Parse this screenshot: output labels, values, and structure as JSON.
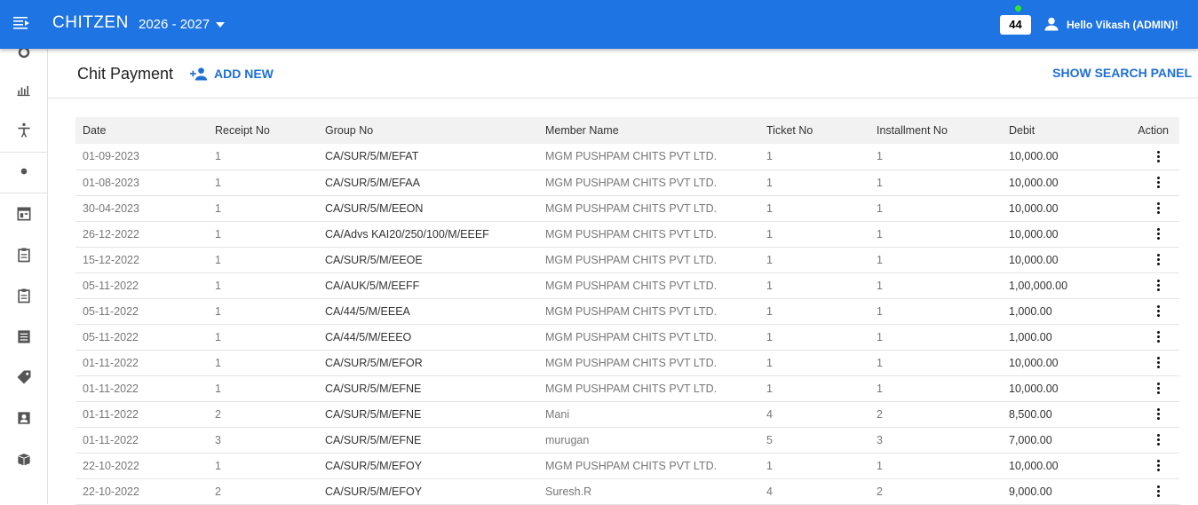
{
  "header": {
    "brand": "CHITZEN",
    "year": "2026 - 2027",
    "notification_count": "44",
    "greeting": "Hello Vikash (ADMIN)!"
  },
  "colors": {
    "topbar": "#1e74e2",
    "accent": "#1e6fd6",
    "notif_dot": "#2ee82e"
  },
  "sidebar": {
    "icons": [
      "settings-icon",
      "bar-chart-icon",
      "accessibility-icon",
      "dot-icon",
      "web-icon",
      "clipboard-icon",
      "clipboard-icon",
      "list-icon",
      "tag-icon",
      "account-box-icon",
      "package-icon"
    ]
  },
  "page": {
    "title": "Chit Payment",
    "add_new": "ADD NEW",
    "search_panel": "SHOW SEARCH PANEL"
  },
  "table": {
    "columns": [
      "Date",
      "Receipt No",
      "Group No",
      "Member Name",
      "Ticket No",
      "Installment No",
      "Debit",
      "Action"
    ],
    "rows": [
      [
        "01-09-2023",
        "1",
        "CA/SUR/5/M/EFAT",
        "MGM PUSHPAM CHITS PVT LTD.",
        "1",
        "1",
        "10,000.00"
      ],
      [
        "01-08-2023",
        "1",
        "CA/SUR/5/M/EFAA",
        "MGM PUSHPAM CHITS PVT LTD.",
        "1",
        "1",
        "10,000.00"
      ],
      [
        "30-04-2023",
        "1",
        "CA/SUR/5/M/EEON",
        "MGM PUSHPAM CHITS PVT LTD.",
        "1",
        "1",
        "10,000.00"
      ],
      [
        "26-12-2022",
        "1",
        "CA/Advs KAI20/250/100/M/EEEF",
        "MGM PUSHPAM CHITS PVT LTD.",
        "1",
        "1",
        "10,000.00"
      ],
      [
        "15-12-2022",
        "1",
        "CA/SUR/5/M/EEOE",
        "MGM PUSHPAM CHITS PVT LTD.",
        "1",
        "1",
        "10,000.00"
      ],
      [
        "05-11-2022",
        "1",
        "CA/AUK/5/M/EEFF",
        "MGM PUSHPAM CHITS PVT LTD.",
        "1",
        "1",
        "1,00,000.00"
      ],
      [
        "05-11-2022",
        "1",
        "CA/44/5/M/EEEA",
        "MGM PUSHPAM CHITS PVT LTD.",
        "1",
        "1",
        "1,000.00"
      ],
      [
        "05-11-2022",
        "1",
        "CA/44/5/M/EEEO",
        "MGM PUSHPAM CHITS PVT LTD.",
        "1",
        "1",
        "1,000.00"
      ],
      [
        "01-11-2022",
        "1",
        "CA/SUR/5/M/EFOR",
        "MGM PUSHPAM CHITS PVT LTD.",
        "1",
        "1",
        "10,000.00"
      ],
      [
        "01-11-2022",
        "1",
        "CA/SUR/5/M/EFNE",
        "MGM PUSHPAM CHITS PVT LTD.",
        "1",
        "1",
        "10,000.00"
      ],
      [
        "01-11-2022",
        "2",
        "CA/SUR/5/M/EFNE",
        "Mani",
        "4",
        "2",
        "8,500.00"
      ],
      [
        "01-11-2022",
        "3",
        "CA/SUR/5/M/EFNE",
        "murugan",
        "5",
        "3",
        "7,000.00"
      ],
      [
        "22-10-2022",
        "1",
        "CA/SUR/5/M/EFOY",
        "MGM PUSHPAM CHITS PVT LTD.",
        "1",
        "1",
        "10,000.00"
      ],
      [
        "22-10-2022",
        "2",
        "CA/SUR/5/M/EFOY",
        "Suresh.R",
        "4",
        "2",
        "9,000.00"
      ]
    ]
  }
}
